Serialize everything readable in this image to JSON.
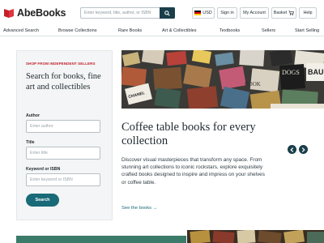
{
  "header": {
    "logo_text": "AbeBooks",
    "search_placeholder": "Enter keyword, title, author, or ISBN",
    "currency": "USD",
    "sign_in": "Sign in",
    "my_account": "My Account",
    "basket": "Basket",
    "help": "Help"
  },
  "nav": {
    "items": [
      "Advanced Search",
      "Browse Collections",
      "Rare Books",
      "Art & Collectibles",
      "Textbooks",
      "Sellers",
      "Start Selling"
    ]
  },
  "panel": {
    "eyebrow": "SHOP FROM INDEPENDENT SELLERS",
    "heading": "Search for books, fine art and collectibles",
    "author_label": "Author",
    "author_placeholder": "Enter author",
    "title_label": "Title",
    "title_placeholder": "Enter title",
    "keyword_label": "Keyword or ISBN",
    "keyword_placeholder": "Enter keyword or ISBN",
    "submit": "Search"
  },
  "hero": {
    "title": "Coffee table books for every collection",
    "text": "Discover visual masterpieces that transform any space. From stunning art collections to iconic rockstars, explore exquisitely crafted books designed to inspire and impress on your shelves or coffee table.",
    "link": "See the books →",
    "book_labels": [
      "CHANEL",
      "DOGS",
      "BAU",
      "BOOK"
    ]
  },
  "colors": {
    "brand_red": "#c3202c",
    "dark_teal": "#1a3f4a",
    "button_teal": "#1a6b79",
    "panel_bg": "#f3f5f6"
  },
  "icons": {
    "logo": "abebooks-logo-icon",
    "search": "search-icon",
    "basket": "basket-icon",
    "prev": "chevron-left-icon",
    "next": "chevron-right-icon"
  }
}
